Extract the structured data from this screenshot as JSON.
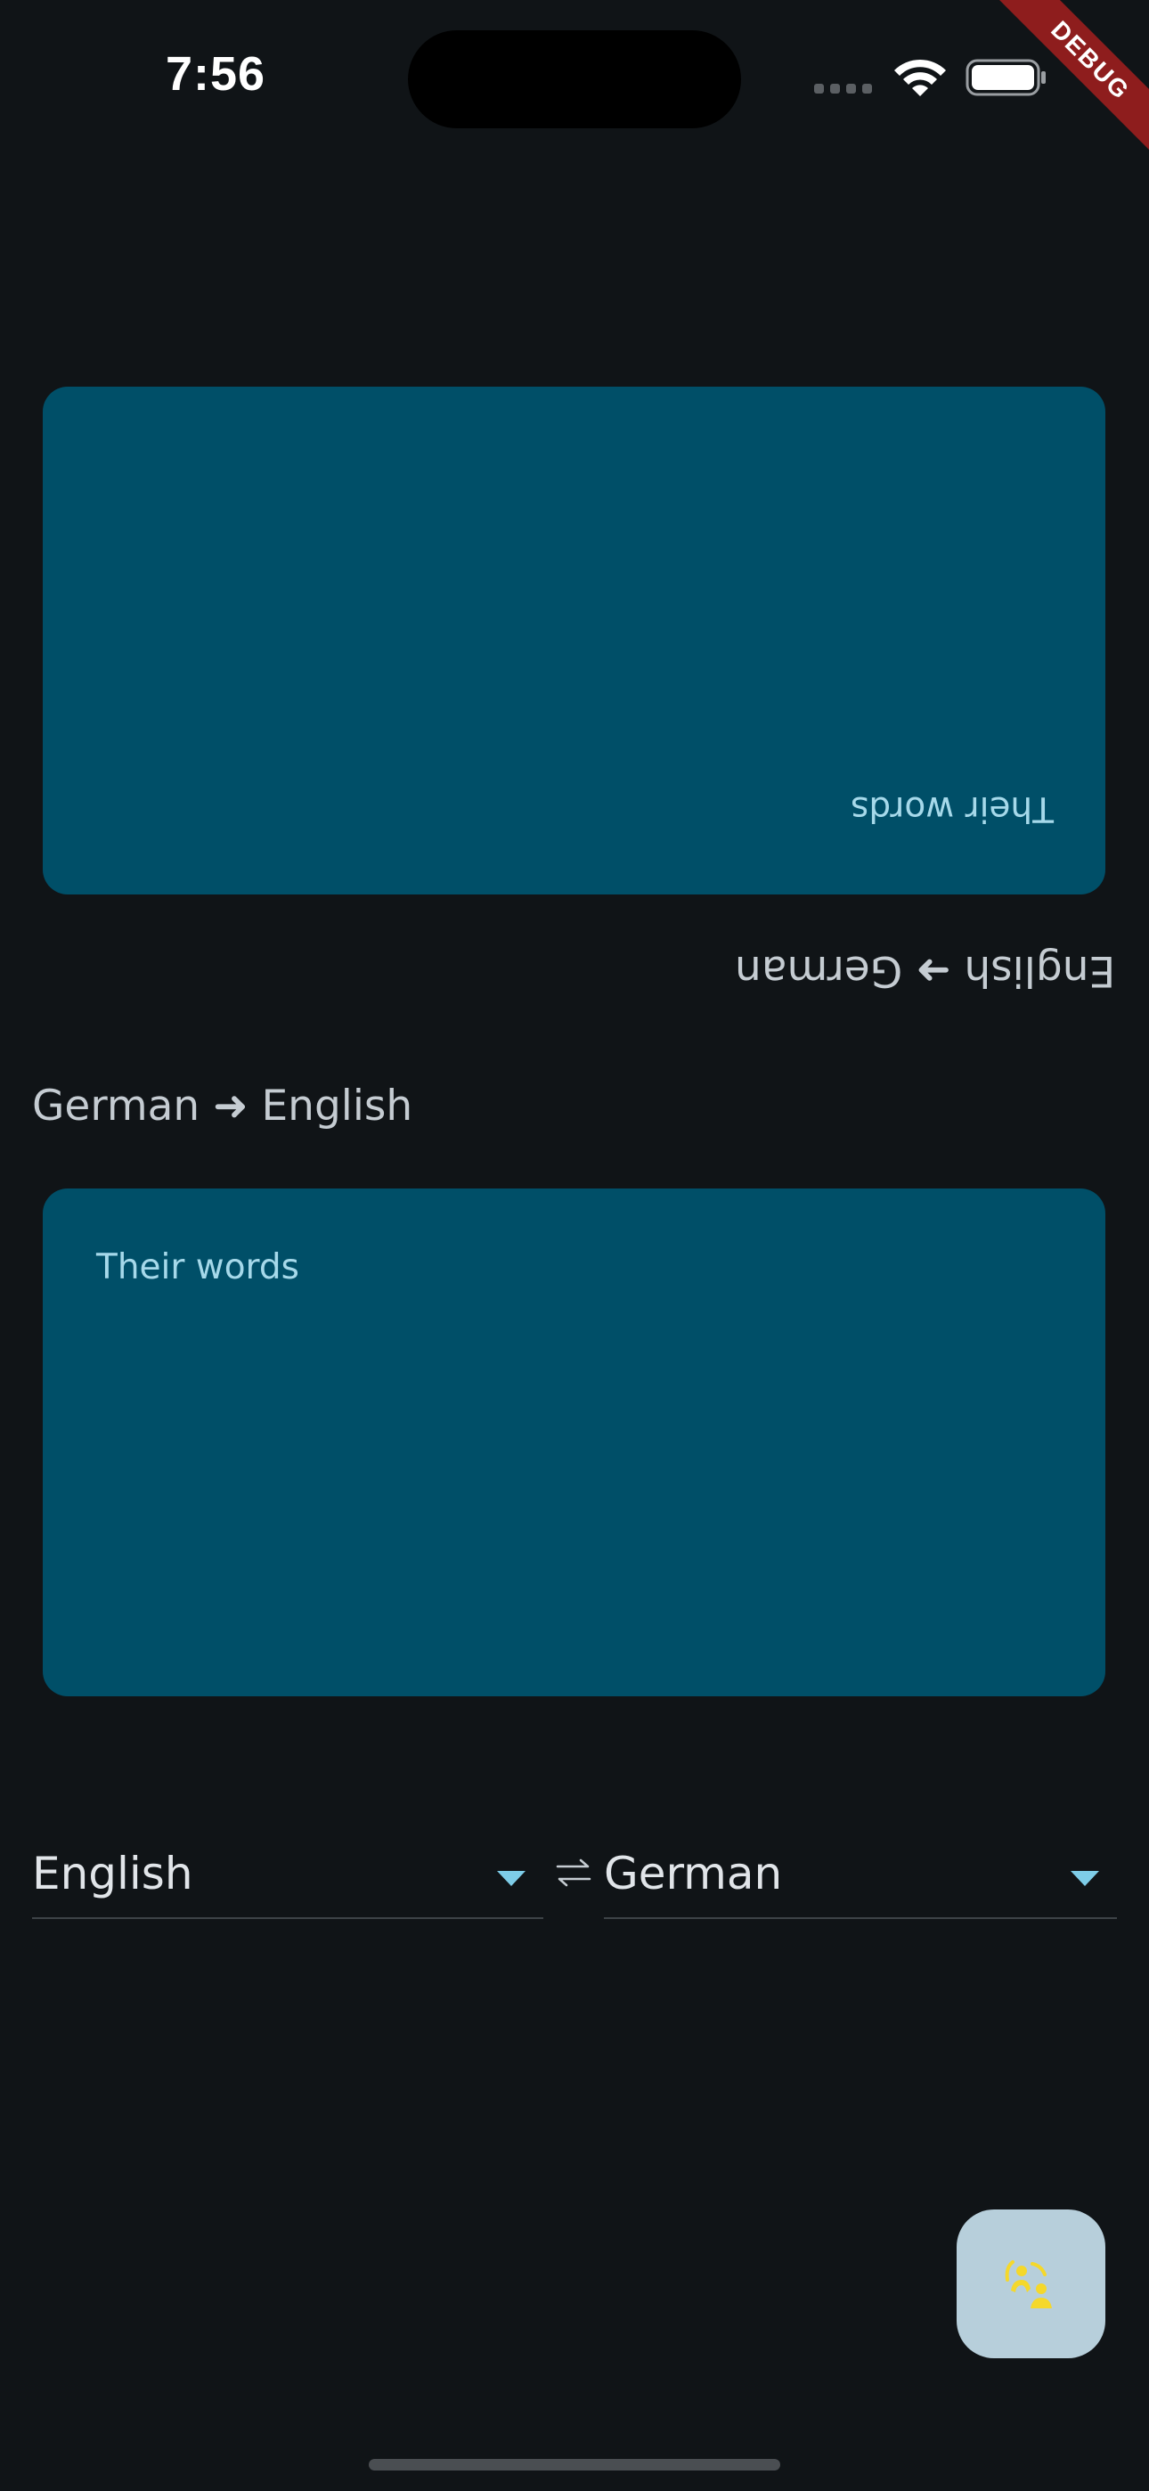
{
  "status_bar": {
    "time": "7:56",
    "debug_banner": "DEBUG"
  },
  "conversation": {
    "top_card": {
      "text": "Their words"
    },
    "top_direction_label": "English ➜ German",
    "bottom_direction_label": "German ➜ English",
    "bottom_card": {
      "text": "Their words"
    }
  },
  "language_selector": {
    "source_language": "English",
    "target_language": "German",
    "swap_icon": "swap-horiz-icon",
    "caret_icon": "arrow-drop-down-icon"
  },
  "fab": {
    "icon": "conversation-icon",
    "icon_color": "#f5d82b"
  },
  "colors": {
    "background": "#101417",
    "card": "#004f68",
    "card_text": "#a6d9ea",
    "accent": "#7ecde8",
    "fab_background": "#b7cfdb"
  }
}
